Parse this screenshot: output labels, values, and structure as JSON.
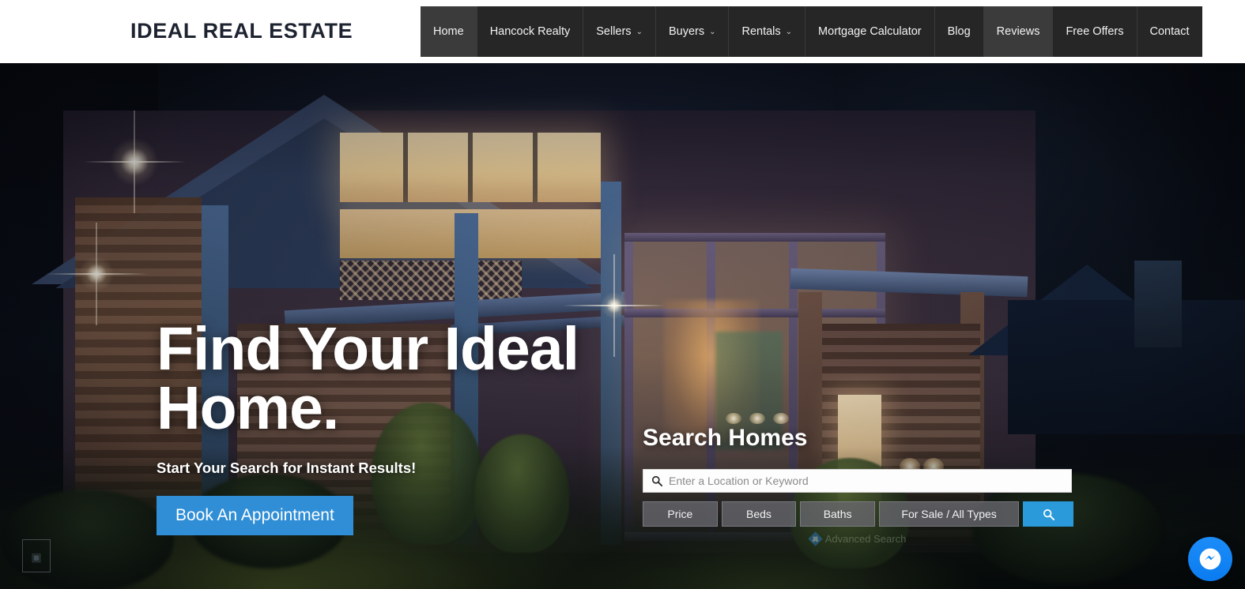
{
  "header": {
    "logo": "IDEAL REAL ESTATE",
    "nav": [
      {
        "label": "Home",
        "active": true,
        "dropdown": false
      },
      {
        "label": "Hancock Realty",
        "active": false,
        "dropdown": false
      },
      {
        "label": "Sellers",
        "active": false,
        "dropdown": true
      },
      {
        "label": "Buyers",
        "active": false,
        "dropdown": true
      },
      {
        "label": "Rentals",
        "active": false,
        "dropdown": true
      },
      {
        "label": "Mortgage Calculator",
        "active": false,
        "dropdown": false
      },
      {
        "label": "Blog",
        "active": false,
        "dropdown": false
      },
      {
        "label": "Reviews",
        "active": true,
        "dropdown": false
      },
      {
        "label": "Free Offers",
        "active": false,
        "dropdown": false
      },
      {
        "label": "Contact",
        "active": false,
        "dropdown": false
      }
    ],
    "chevron": "⌄"
  },
  "hero": {
    "heading_line1": "Find Your Ideal",
    "heading_line2": "Home.",
    "subheading": "Start Your Search for Instant Results!",
    "cta_label": "Book An Appointment"
  },
  "search": {
    "title": "Search Homes",
    "placeholder": "Enter a Location or Keyword",
    "input_value": "",
    "search_icon": "search-icon",
    "filters": [
      {
        "label": "Price"
      },
      {
        "label": "Beds"
      },
      {
        "label": "Baths"
      },
      {
        "label": "For Sale / All Types"
      }
    ],
    "submit_icon": "search-icon",
    "advanced_label": "Advanced Search",
    "advanced_icon": "plus-diamond-icon"
  },
  "widgets": {
    "messenger_icon": "messenger-icon",
    "broken_image_glyph": "▣"
  },
  "colors": {
    "accent_blue": "#2f8ed6",
    "search_blue": "#2a9ada",
    "nav_bg": "#262626",
    "nav_active_bg": "#3b3b3b",
    "header_bg": "#ffffff",
    "logo_text": "#1d2330",
    "messenger_blue": "#0a7cf0"
  }
}
